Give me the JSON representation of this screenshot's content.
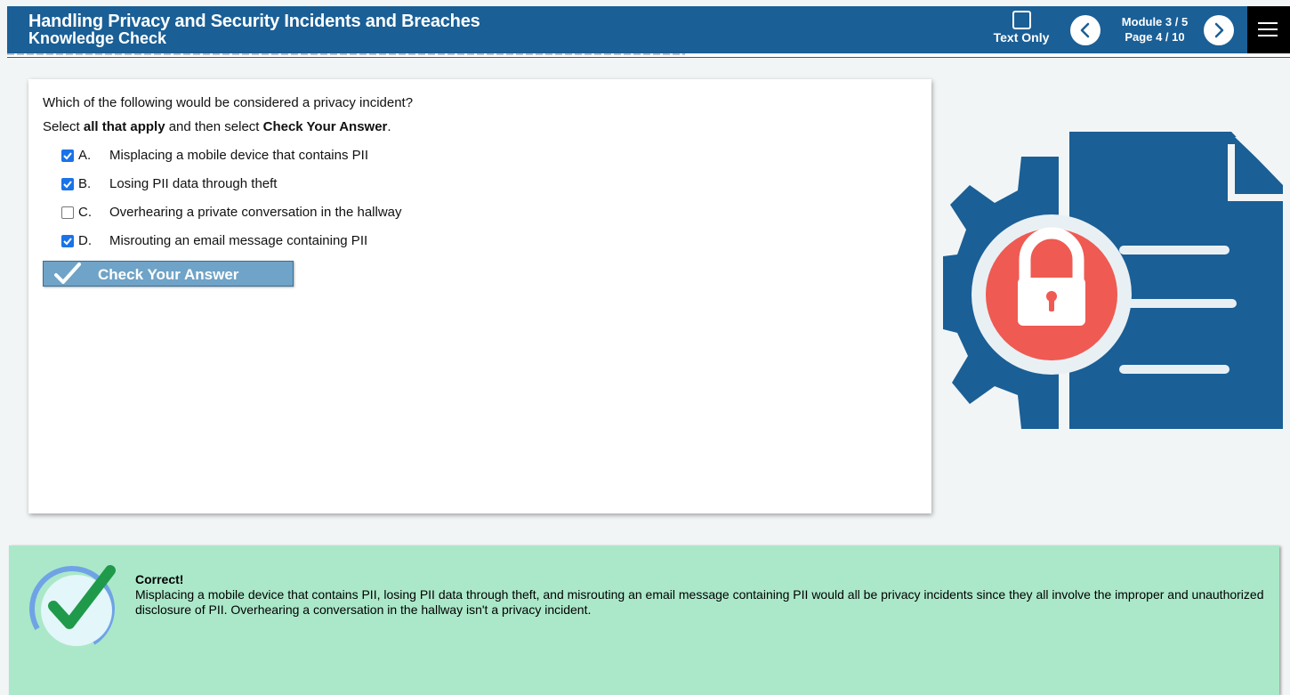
{
  "header": {
    "title": "Handling Privacy and Security Incidents and Breaches",
    "subtitle": "Knowledge Check",
    "text_only_label": "Text Only",
    "module": "Module 3 / 5",
    "page": "Page 4 / 10"
  },
  "question": {
    "prompt": "Which of the following would be considered a privacy incident?",
    "instruction_pre": "Select ",
    "instruction_bold1": "all that apply",
    "instruction_mid": " and then select ",
    "instruction_bold2": "Check Your Answer",
    "instruction_post": ".",
    "options": [
      {
        "letter": "A.",
        "text": "Misplacing a mobile device that contains PII",
        "checked": true
      },
      {
        "letter": "B.",
        "text": "Losing PII data through theft",
        "checked": true
      },
      {
        "letter": "C.",
        "text": "Overhearing a private conversation in the hallway",
        "checked": false
      },
      {
        "letter": "D.",
        "text": "Misrouting an email message containing PII",
        "checked": true
      }
    ],
    "check_button": "Check Your Answer"
  },
  "feedback": {
    "title": "Correct!",
    "text": "Misplacing a mobile device that contains PII, losing PII data through theft, and misrouting an email message containing PII would all be privacy incidents since they all involve the improper and unauthorized disclosure of PII. Overhearing a conversation in the hallway isn't a privacy incident."
  },
  "colors": {
    "header_bg": "#1a5f96",
    "feedback_bg": "#abe8c9",
    "lock_red": "#ef5a52",
    "gear_blue": "#1a5f96",
    "checkbox_blue": "#1a73e8"
  },
  "icons": {
    "prev": "chevron-left-icon",
    "next": "chevron-right-icon",
    "menu": "hamburger-menu-icon",
    "check": "checkmark-icon",
    "illustration": "gear-lock-document-icon",
    "feedback": "correct-checkmark-icon"
  }
}
